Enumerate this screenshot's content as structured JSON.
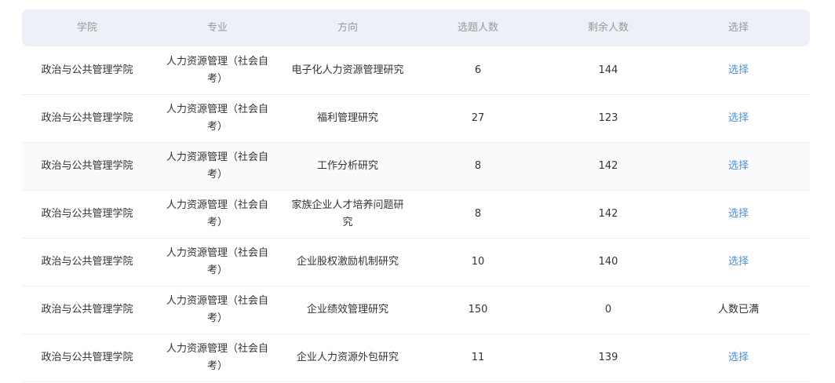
{
  "headers": [
    "学院",
    "专业",
    "方向",
    "选题人数",
    "剩余人数",
    "选择"
  ],
  "rows": [
    {
      "college": "政治与公共管理学院",
      "major": "人力资源管理（社会自考）",
      "direction": "电子化人力资源管理研究",
      "selected": "6",
      "remaining": "144",
      "action": "选择",
      "action_type": "link"
    },
    {
      "college": "政治与公共管理学院",
      "major": "人力资源管理（社会自考）",
      "direction": "福利管理研究",
      "selected": "27",
      "remaining": "123",
      "action": "选择",
      "action_type": "link"
    },
    {
      "college": "政治与公共管理学院",
      "major": "人力资源管理（社会自考）",
      "direction": "工作分析研究",
      "selected": "8",
      "remaining": "142",
      "action": "选择",
      "action_type": "link"
    },
    {
      "college": "政治与公共管理学院",
      "major": "人力资源管理（社会自考）",
      "direction": "家族企业人才培养问题研究",
      "selected": "8",
      "remaining": "142",
      "action": "选择",
      "action_type": "link"
    },
    {
      "college": "政治与公共管理学院",
      "major": "人力资源管理（社会自考）",
      "direction": "企业股权激励机制研究",
      "selected": "10",
      "remaining": "140",
      "action": "选择",
      "action_type": "link"
    },
    {
      "college": "政治与公共管理学院",
      "major": "人力资源管理（社会自考）",
      "direction": "企业绩效管理研究",
      "selected": "150",
      "remaining": "0",
      "action": "人数已满",
      "action_type": "text"
    },
    {
      "college": "政治与公共管理学院",
      "major": "人力资源管理（社会自考）",
      "direction": "企业人力资源外包研究",
      "selected": "11",
      "remaining": "139",
      "action": "选择",
      "action_type": "link"
    }
  ]
}
